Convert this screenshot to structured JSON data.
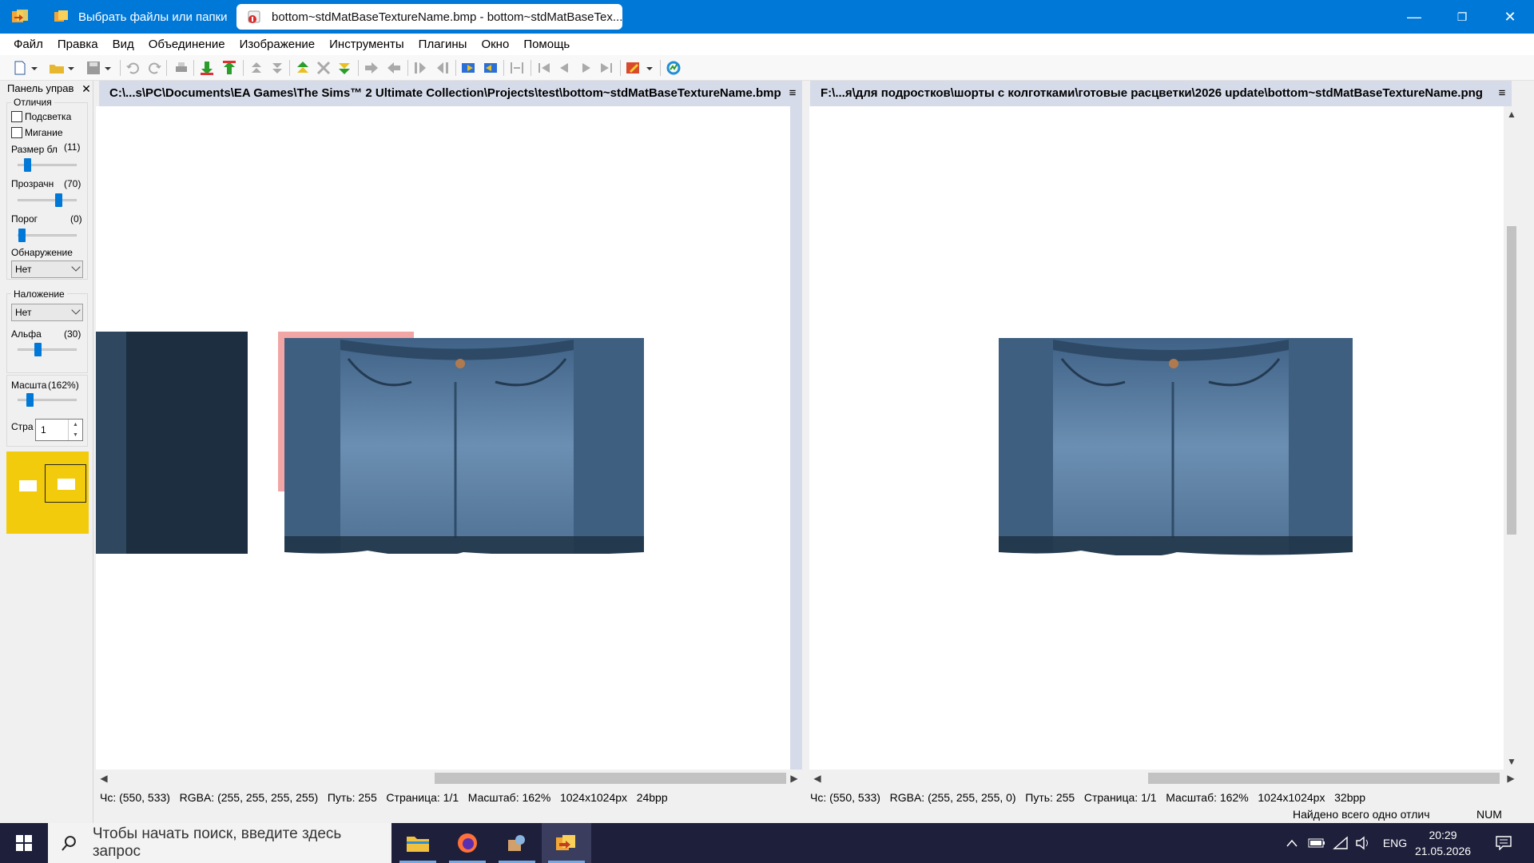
{
  "window": {
    "tab_inactive": "Выбрать файлы или папки",
    "tab_active": "bottom~stdMatBaseTextureName.bmp - bottom~stdMatBaseTex...",
    "minimize": "—",
    "maximize": "❐",
    "close": "✕"
  },
  "menu": [
    "Файл",
    "Правка",
    "Вид",
    "Объединение",
    "Изображение",
    "Инструменты",
    "Плагины",
    "Окно",
    "Помощь"
  ],
  "panel": {
    "title": "Панель управ",
    "close": "✕",
    "diff_group": "Отличия",
    "highlight": "Подсветка",
    "blink": "Мигание",
    "block_size_label": "Размер бл",
    "block_size_value": "(11)",
    "opacity_label": "Прозрачн",
    "opacity_value": "(70)",
    "threshold_label": "Порог",
    "threshold_value": "(0)",
    "detection_label": "Обнаружение",
    "detection_value": "Нет",
    "overlay_group": "Наложение",
    "overlay_value": "Нет",
    "alpha_label": "Альфа",
    "alpha_value": "(30)",
    "scale_label": "Масшта",
    "scale_value": "(162%)",
    "page_label": "Стра",
    "page_value": "1",
    "sliders": {
      "block_size": 0.1,
      "opacity": 0.7,
      "threshold": 0.0,
      "alpha": 0.3,
      "scale": 0.16
    }
  },
  "left": {
    "path": "C:\\...s\\PC\\Documents\\EA Games\\The Sims™ 2 Ultimate Collection\\Projects\\test\\bottom~stdMatBaseTextureName.bmp",
    "status": [
      "Чс: (550, 533)",
      "RGBA: (255, 255, 255, 255)",
      "Путь: 255",
      "Страница: 1/1",
      "Масштаб: 162%",
      "1024x1024px",
      "24bpp"
    ]
  },
  "right": {
    "path": "F:\\...я\\для подростков\\шорты с колготками\\готовые расцветки\\2026 update\\bottom~stdMatBaseTextureName.png",
    "status": [
      "Чс: (550, 533)",
      "RGBA: (255, 255, 255, 0)",
      "Путь: 255",
      "Страница: 1/1",
      "Масштаб: 162%",
      "1024x1024px",
      "32bpp"
    ]
  },
  "doc_menu_icon": "≡",
  "status_bottom": {
    "message": "Найдено всего одно отлич",
    "num": "NUM"
  },
  "taskbar": {
    "search_placeholder": "Чтобы начать поиск, введите здесь запрос",
    "lang": "ENG",
    "time": "20:29",
    "date": "21.05.2026"
  },
  "colors": {
    "titlebar": "#0078d7",
    "doc_tab": "#d6dbe9",
    "navigator": "#f2cc0c",
    "denim": "#4b6f93",
    "taskbar": "#1e1f3b"
  }
}
